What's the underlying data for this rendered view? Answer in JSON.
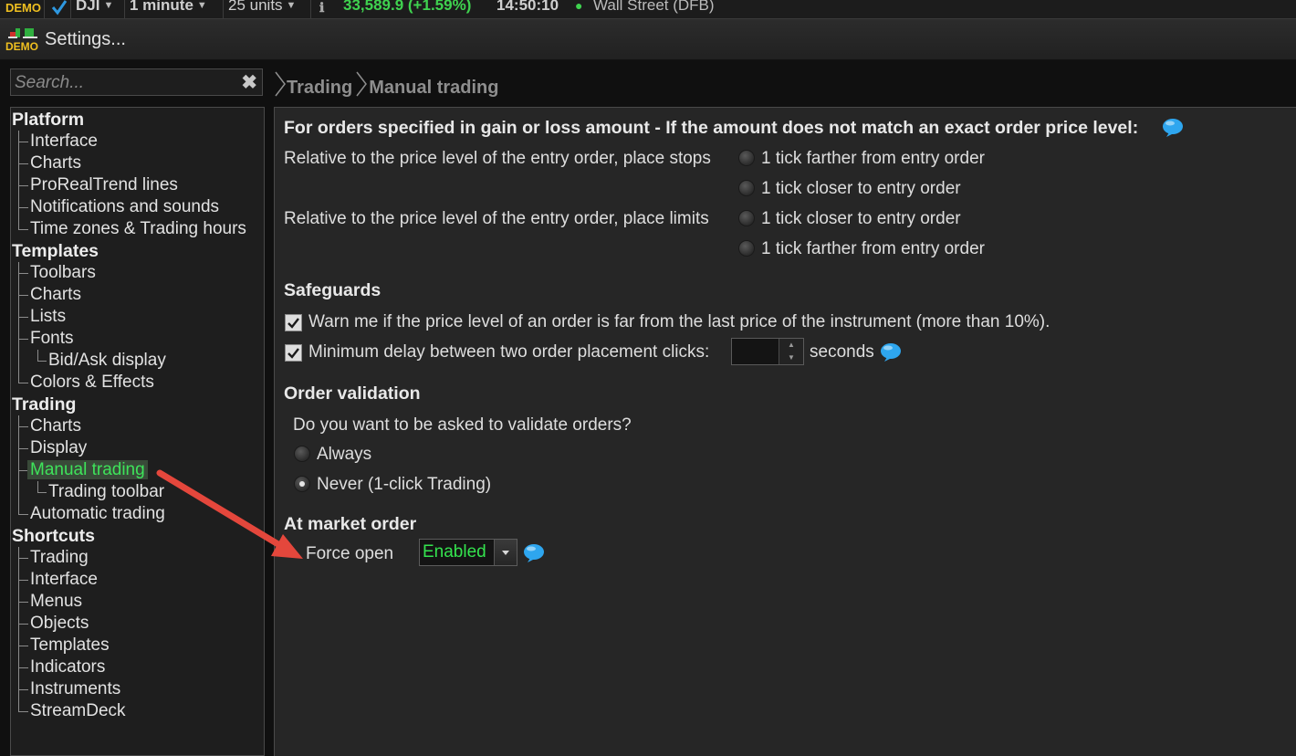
{
  "topbar": {
    "logo_text": "DEMO",
    "instrument": "DJI",
    "timeframe": "1 minute",
    "units": "25 units",
    "price": "33,589.9 (+1.59%)",
    "time": "14:50:10",
    "market": "Wall Street (DFB)",
    "price_color": "#3fd24f"
  },
  "window": {
    "logo_text": "DEMO",
    "title": "Settings..."
  },
  "search": {
    "placeholder": "Search..."
  },
  "breadcrumb": {
    "items": [
      "Trading",
      "Manual trading"
    ]
  },
  "tree": {
    "platform": {
      "label": "Platform",
      "items": [
        "Interface",
        "Charts",
        "ProRealTrend lines",
        "Notifications and sounds",
        "Time zones & Trading hours"
      ]
    },
    "templates": {
      "label": "Templates",
      "items": [
        "Toolbars",
        "Charts",
        "Lists",
        "Fonts",
        "Bid/Ask display",
        "Colors & Effects"
      ]
    },
    "trading": {
      "label": "Trading",
      "items": [
        "Charts",
        "Display",
        "Manual trading",
        "Trading toolbar",
        "Automatic trading"
      ]
    },
    "shortcuts": {
      "label": "Shortcuts",
      "items": [
        "Trading",
        "Interface",
        "Menus",
        "Objects",
        "Templates",
        "Indicators",
        "Instruments",
        "StreamDeck"
      ]
    },
    "selected": "Manual trading"
  },
  "content": {
    "gain_loss": {
      "title": "For orders specified in gain or loss amount - If the amount does not match an exact order price level:",
      "stops_label": "Relative to the price level of the entry order, place stops",
      "stops_options": [
        "1 tick farther from entry order",
        "1 tick closer to entry order"
      ],
      "limits_label": "Relative to the price level of the entry order, place limits",
      "limits_options": [
        "1 tick closer to entry order",
        "1 tick farther from entry order"
      ]
    },
    "safeguards": {
      "title": "Safeguards",
      "warn_label": "Warn me if the price level of an order is far from the last price of the instrument (more than 10%).",
      "warn_checked": true,
      "delay_label": "Minimum delay between two order placement clicks:",
      "delay_checked": true,
      "delay_value": "",
      "delay_unit": "seconds"
    },
    "order_validation": {
      "title": "Order validation",
      "question": "Do you want to be asked to validate orders?",
      "options": [
        "Always",
        "Never (1-click Trading)"
      ],
      "selected": "Never (1-click Trading)"
    },
    "at_market": {
      "title": "At market order",
      "force_open_label": "Force open",
      "force_open_value": "Enabled"
    }
  },
  "colors": {
    "selected_green": "#3ee35a",
    "arrow_red": "#e4473c",
    "bubble_blue": "#2ea6ef"
  }
}
